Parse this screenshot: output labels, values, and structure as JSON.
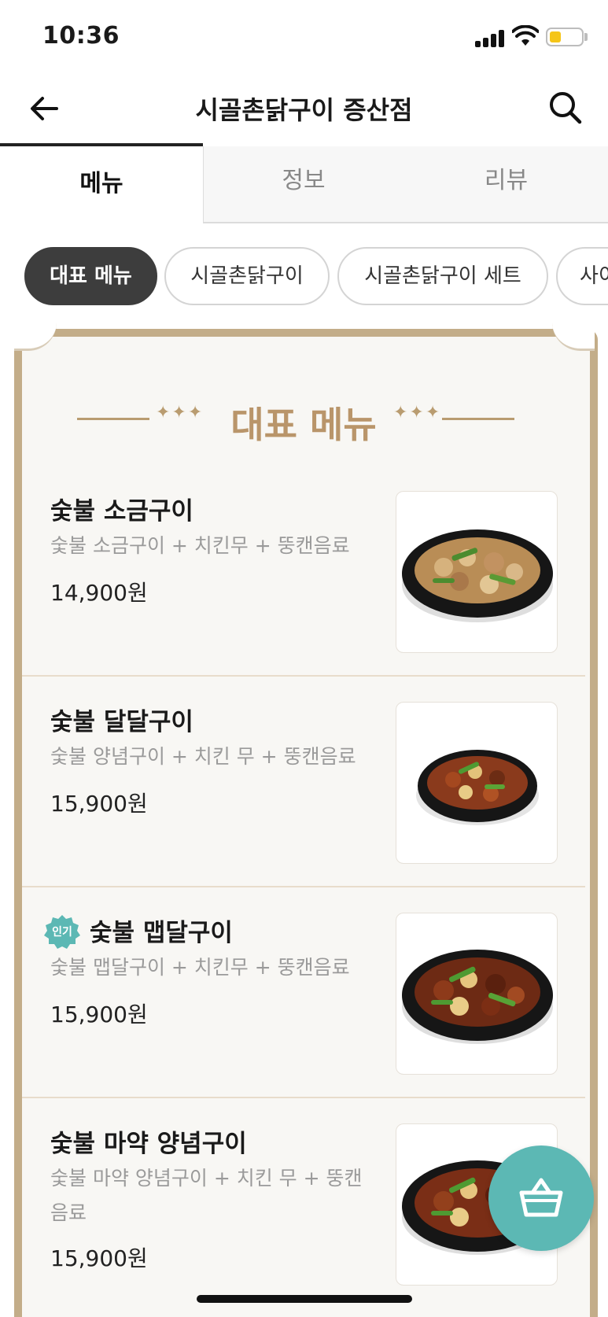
{
  "status_bar": {
    "time": "10:36"
  },
  "header": {
    "title": "시골촌닭구이 증산점"
  },
  "tabs": [
    {
      "label": "메뉴"
    },
    {
      "label": "정보"
    },
    {
      "label": "리뷰"
    }
  ],
  "chips": [
    {
      "label": "대표 메뉴"
    },
    {
      "label": "시골촌닭구이"
    },
    {
      "label": "시골촌닭구이 세트"
    },
    {
      "label": "사이"
    }
  ],
  "section": {
    "title": "대표 메뉴",
    "ornament": "✦✦✦"
  },
  "menu_items": [
    {
      "name": "숯불 소금구이",
      "description": "숯불 소금구이 + 치킨무 + 뚱캔음료",
      "price": "14,900원",
      "popular": ""
    },
    {
      "name": "숯불 달달구이",
      "description": "숯불 양념구이 + 치킨 무 + 뚱캔음료",
      "price": "15,900원",
      "popular": ""
    },
    {
      "name": "숯불 맵달구이",
      "description": "숯불 맵달구이 + 치킨무 + 뚱캔음료",
      "price": "15,900원",
      "popular": "인기"
    },
    {
      "name": "숯불 마약 양념구이",
      "description": "숯불 마약 양념구이 + 치킨 무 + 뚱캔음료",
      "price": "15,900원",
      "popular": ""
    }
  ],
  "colors": {
    "accent_teal": "#5cb8b4",
    "gold": "#b9956a",
    "chip_active": "#3d3d3d"
  },
  "icons": {
    "back": "arrow-left-icon",
    "search": "search-icon",
    "cart": "basket-icon"
  }
}
